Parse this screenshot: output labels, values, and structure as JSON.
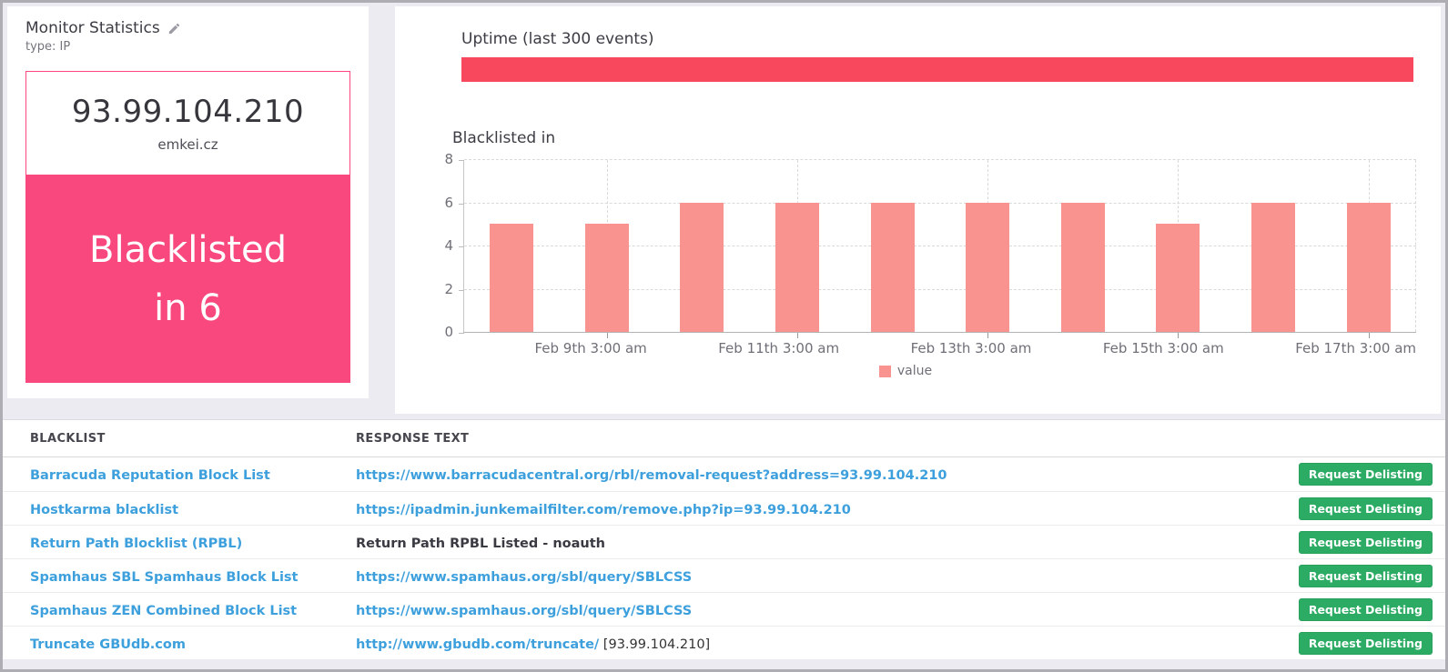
{
  "left_panel": {
    "title": "Monitor Statistics",
    "subtitle": "type: IP",
    "ip": "93.99.104.210",
    "hostname": "emkei.cz",
    "status_line1": "Blacklisted",
    "status_line2": "in 6"
  },
  "uptime": {
    "title": "Uptime (last 300 events)"
  },
  "chart_data": {
    "type": "bar",
    "title": "Blacklisted in",
    "categories": [
      "",
      "Feb 9th 3:00 am",
      "",
      "Feb 11th 3:00 am",
      "",
      "Feb 13th 3:00 am",
      "",
      "Feb 15th 3:00 am",
      "",
      "Feb 17th 3:00 am"
    ],
    "values": [
      5,
      5,
      6,
      6,
      6,
      6,
      6,
      5,
      6,
      6
    ],
    "ylim": [
      0,
      8
    ],
    "yticks": [
      0,
      2,
      4,
      6,
      8
    ],
    "ylabel": "",
    "xlabel": "",
    "legend": [
      "value"
    ],
    "legend_position": "bottom-center",
    "grid": true,
    "bar_color": "#f9938f"
  },
  "table": {
    "columns": [
      "BLACKLIST",
      "RESPONSE TEXT"
    ],
    "button_label": "Request Delisting",
    "rows": [
      {
        "name": "Barracuda Reputation Block List",
        "response_link": "https://www.barracudacentral.org/rbl/removal-request?address=93.99.104.210",
        "response_text": ""
      },
      {
        "name": "Hostkarma blacklist",
        "response_link": "https://ipadmin.junkemailfilter.com/remove.php?ip=93.99.104.210",
        "response_text": ""
      },
      {
        "name": "Return Path Blocklist (RPBL)",
        "response_link": "",
        "response_text": "Return Path RPBL Listed - noauth"
      },
      {
        "name": "Spamhaus SBL Spamhaus Block List",
        "response_link": "https://www.spamhaus.org/sbl/query/SBLCSS",
        "response_text": ""
      },
      {
        "name": "Spamhaus ZEN Combined Block List",
        "response_link": "https://www.spamhaus.org/sbl/query/SBLCSS",
        "response_text": ""
      },
      {
        "name": "Truncate GBUdb.com",
        "response_link": "http://www.gbudb.com/truncate/",
        "response_text": "[93.99.104.210]"
      }
    ]
  },
  "colors": {
    "accent_pink": "#f8487d",
    "uptime_red": "#f8485e",
    "bar_salmon": "#f9938f",
    "button_green": "#2bab63",
    "link_blue": "#3da0dd"
  }
}
